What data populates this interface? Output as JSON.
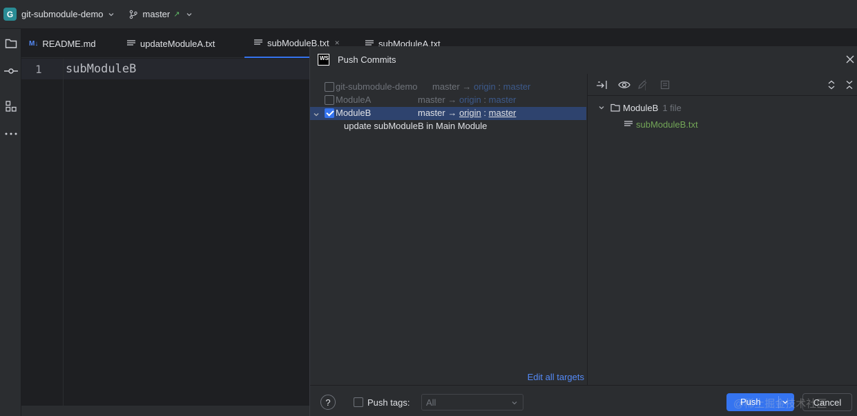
{
  "topbar": {
    "project_badge": "G",
    "project_name": "git-submodule-demo",
    "branch": "master",
    "branch_arrow": "↗"
  },
  "tabs": [
    {
      "icon": "markdown-icon",
      "prefix": "M↓",
      "label": "README.md"
    },
    {
      "icon": "text-file-icon",
      "label": "updateModuleA.txt"
    },
    {
      "icon": "text-file-icon",
      "label": "subModuleB.txt",
      "active": true,
      "close": "×"
    },
    {
      "icon": "text-file-icon",
      "label": "subModuleA.txt"
    }
  ],
  "editor": {
    "line_number": "1",
    "code": "subModuleB"
  },
  "dialog": {
    "logo": "WS",
    "title": "Push Commits",
    "repos": [
      {
        "name": "git-submodule-demo",
        "local": "master",
        "arrow": "→",
        "remote": "origin",
        "sep": ":",
        "remote_branch": "master",
        "checked": false
      },
      {
        "name": "ModuleA",
        "local": "master",
        "arrow": "→",
        "remote": "origin",
        "sep": ":",
        "remote_branch": "master",
        "checked": false
      },
      {
        "name": "ModuleB",
        "local": "master",
        "arrow": "→",
        "remote": "origin",
        "sep": ":",
        "remote_branch": "master",
        "checked": true
      }
    ],
    "commit_message": "update subModuleB in Main Module",
    "edit_all_targets": "Edit all targets",
    "tree": {
      "folder": "ModuleB",
      "count": "1 file",
      "file": "subModuleB.txt"
    },
    "bottom": {
      "help": "?",
      "push_tags_label": "Push tags:",
      "push_tags_value": "All",
      "push_label": "Push",
      "cancel_label": "Cancel"
    }
  },
  "watermark": "@稀土掘金技术社区",
  "colors": {
    "accent": "#3574f0",
    "selection": "#2e436e",
    "added_file": "#73a657",
    "link": "#548af7"
  }
}
